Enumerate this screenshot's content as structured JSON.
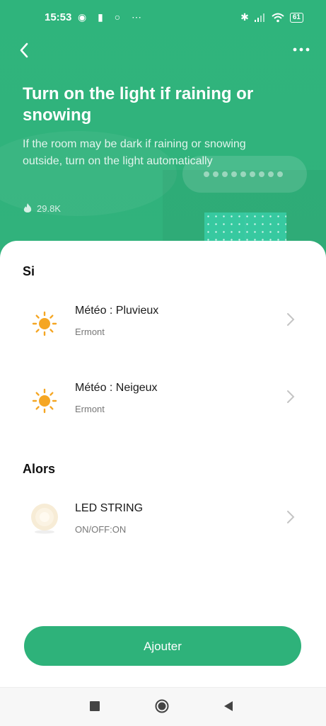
{
  "status_bar": {
    "time": "15:53",
    "left_icons": "◉ ▮ ○ ⋯",
    "battery": "61"
  },
  "hero": {
    "title": "Turn on the light if raining or snowing",
    "description": "If the room may be dark if raining or snowing outside, turn on the light automatically",
    "popularity": "29.8K"
  },
  "if_section": {
    "title": "Si",
    "conditions": [
      {
        "name": "Météo : Pluvieux",
        "location": "Ermont",
        "icon": "sun-icon"
      },
      {
        "name": "Météo : Neigeux",
        "location": "Ermont",
        "icon": "sun-icon"
      }
    ]
  },
  "then_section": {
    "title": "Alors",
    "actions": [
      {
        "name": "LED STRING",
        "state": "ON/OFF:ON",
        "icon": "led-lamp-icon"
      }
    ]
  },
  "add_button": {
    "label": "Ajouter"
  },
  "colors": {
    "accent": "#2eb27a",
    "sun": "#f5a623"
  }
}
